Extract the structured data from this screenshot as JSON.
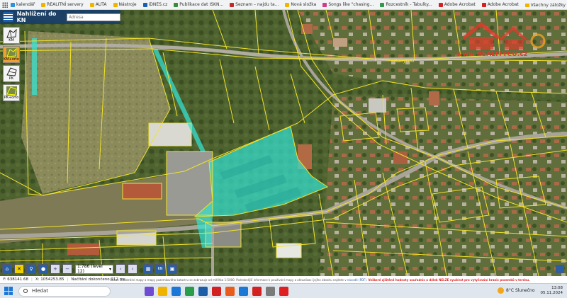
{
  "bookmarks": [
    {
      "label": "kalendář",
      "color": "#2d8fe0"
    },
    {
      "label": "REALITNÍ servery",
      "color": "#f0b400"
    },
    {
      "label": "AUTA",
      "color": "#f0b400"
    },
    {
      "label": "Nástroje",
      "color": "#f0b400"
    },
    {
      "label": "iDNES.cz",
      "color": "#1960b0"
    },
    {
      "label": "Publikace dat ISKN...",
      "color": "#3a8c3a"
    },
    {
      "label": "Seznam – najdu ta...",
      "color": "#c32a2a"
    },
    {
      "label": "Nová složka",
      "color": "#f0b400"
    },
    {
      "label": "Songs like \"chasing...",
      "color": "#d23a8a"
    },
    {
      "label": "Rozcestník - Tabulky...",
      "color": "#2e9a4a"
    },
    {
      "label": "Adobe Acrobat",
      "color": "#d32020"
    },
    {
      "label": "Adobe Acrobat",
      "color": "#d32020"
    }
  ],
  "bookmarks_right": "Všechny záložky",
  "map_header": {
    "title": "Nahlížení do KN",
    "address_placeholder": "Adresa"
  },
  "tools": [
    {
      "label": "KM"
    },
    {
      "label": "KM+orto"
    },
    {
      "label": "PK"
    },
    {
      "label": "PK+orto"
    }
  ],
  "watermark": {
    "brand": "www.REALITYCU.cz",
    "town_label": "Rokytno"
  },
  "bottombar": {
    "scale_label": "1:786 (level 12)",
    "kn_label": "KN"
  },
  "coords": {
    "y": "Y: 638141.68",
    "x": "X: 1054253.85",
    "status": "Načítání dokončeno 912 ms"
  },
  "notice": {
    "text": "Obsah katastrální mapy a mapy pozemkového katastru se zobrazuje od měřítka 1:5000. Podrobnější informace k používání mapy a aktualizaci jejího obsahu najdete",
    "link": "v návodě (PDF).",
    "warn": "Veškeré zjištěné hodnoty souřadnic a délek NELZE využívat pro vytyčování hranic pozemků v terénu."
  },
  "taskbar": {
    "search_label": "Hledat",
    "weather": "8°C  Slunečno",
    "time": "13:08",
    "date": "05.11.2024",
    "apps": [
      "#6f4bd1",
      "#f0b400",
      "#1b78d6",
      "#2a9d4a",
      "#1d5da8",
      "#d32020",
      "#e85b1a",
      "#1b78d6",
      "#d32020",
      "#7a7a7a",
      "#e02020"
    ]
  },
  "colors": {
    "parcel_line": "#f2e22a",
    "highlight": "#35e0d0",
    "header_bg": "#143c6e"
  }
}
